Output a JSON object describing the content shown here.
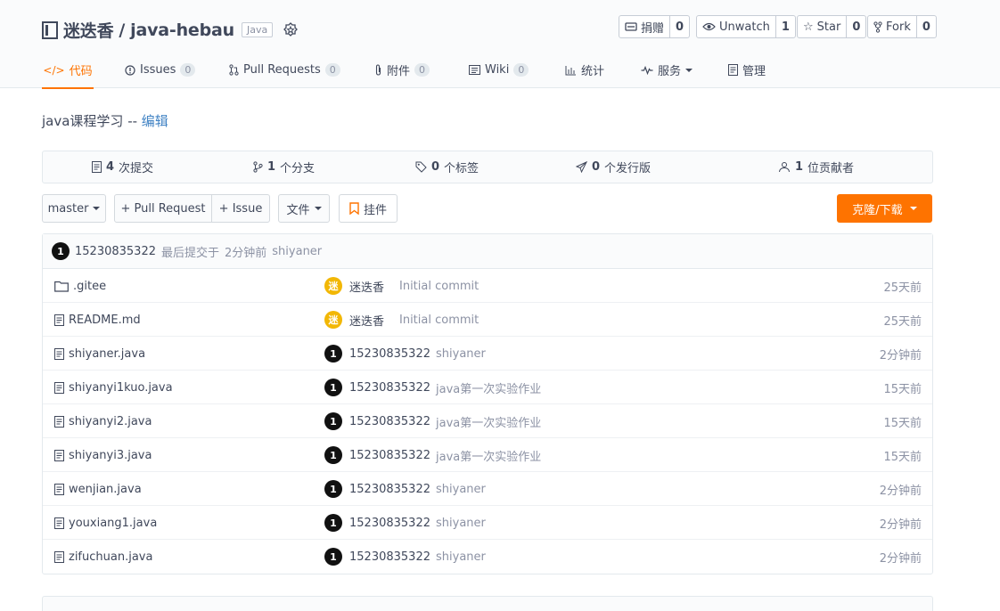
{
  "repo": {
    "owner": "迷迭香",
    "separator": "/",
    "name": "java-hebau",
    "language": "Java"
  },
  "actions": [
    {
      "label": "捐赠",
      "count": "0",
      "icon": "donate-icon"
    },
    {
      "label": "Unwatch",
      "count": "1",
      "icon": "eye-icon"
    },
    {
      "label": "Star",
      "count": "0",
      "icon": "star-icon"
    },
    {
      "label": "Fork",
      "count": "0",
      "icon": "fork-icon"
    }
  ],
  "tabs": [
    {
      "label": "代码",
      "count": null,
      "icon": "code-icon",
      "active": true
    },
    {
      "label": "Issues",
      "count": "0",
      "icon": "issue-icon"
    },
    {
      "label": "Pull Requests",
      "count": "0",
      "icon": "pull-request-icon"
    },
    {
      "label": "附件",
      "count": "0",
      "icon": "attachment-icon"
    },
    {
      "label": "Wiki",
      "count": "0",
      "icon": "wiki-icon"
    },
    {
      "label": "统计",
      "count": null,
      "icon": "stats-icon"
    },
    {
      "label": "服务",
      "count": null,
      "icon": "service-icon"
    },
    {
      "label": "管理",
      "count": null,
      "icon": "manage-icon"
    }
  ],
  "description": {
    "text": "java课程学习 -- ",
    "edit_label": "编辑"
  },
  "stats": [
    {
      "count": "4",
      "label": "次提交",
      "icon": "commit-icon"
    },
    {
      "count": "1",
      "label": "个分支",
      "icon": "branch-icon"
    },
    {
      "count": "0",
      "label": "个标签",
      "icon": "tag-icon"
    },
    {
      "count": "0",
      "label": "个发行版",
      "icon": "release-icon"
    },
    {
      "count": "1",
      "label": "位贡献者",
      "icon": "contributor-icon"
    }
  ],
  "toolbar": {
    "branch": "master",
    "pull_request": "+ Pull Request",
    "issue": "+ Issue",
    "file": "文件",
    "widget": "挂件",
    "clone": "克隆/下载"
  },
  "last_commit": {
    "avatar_text": "1",
    "author": "15230835322",
    "text": "最后提交于",
    "time": "2分钟前",
    "message": "shiyaner"
  },
  "files": [
    {
      "name": ".gitee",
      "type": "folder",
      "avatar": "迷",
      "avatar_color": "gold",
      "author": "迷迭香",
      "message": "Initial commit",
      "time": "25天前"
    },
    {
      "name": "README.md",
      "type": "file",
      "avatar": "迷",
      "avatar_color": "gold",
      "author": "迷迭香",
      "message": "Initial commit",
      "time": "25天前"
    },
    {
      "name": "shiyaner.java",
      "type": "file",
      "avatar": "1",
      "avatar_color": "black",
      "author": "15230835322",
      "message": "shiyaner",
      "time": "2分钟前"
    },
    {
      "name": "shiyanyi1kuo.java",
      "type": "file",
      "avatar": "1",
      "avatar_color": "black",
      "author": "15230835322",
      "message": "java第一次实验作业",
      "time": "15天前"
    },
    {
      "name": "shiyanyi2.java",
      "type": "file",
      "avatar": "1",
      "avatar_color": "black",
      "author": "15230835322",
      "message": "java第一次实验作业",
      "time": "15天前"
    },
    {
      "name": "shiyanyi3.java",
      "type": "file",
      "avatar": "1",
      "avatar_color": "black",
      "author": "15230835322",
      "message": "java第一次实验作业",
      "time": "15天前"
    },
    {
      "name": "wenjian.java",
      "type": "file",
      "avatar": "1",
      "avatar_color": "black",
      "author": "15230835322",
      "message": "shiyaner",
      "time": "2分钟前"
    },
    {
      "name": "youxiang1.java",
      "type": "file",
      "avatar": "1",
      "avatar_color": "black",
      "author": "15230835322",
      "message": "shiyaner",
      "time": "2分钟前"
    },
    {
      "name": "zifuchuan.java",
      "type": "file",
      "avatar": "1",
      "avatar_color": "black",
      "author": "15230835322",
      "message": "shiyaner",
      "time": "2分钟前"
    }
  ],
  "colors": {
    "accent": "#fe7300",
    "link": "#4183c4",
    "text": "#40485b",
    "muted": "#8c92a4"
  }
}
